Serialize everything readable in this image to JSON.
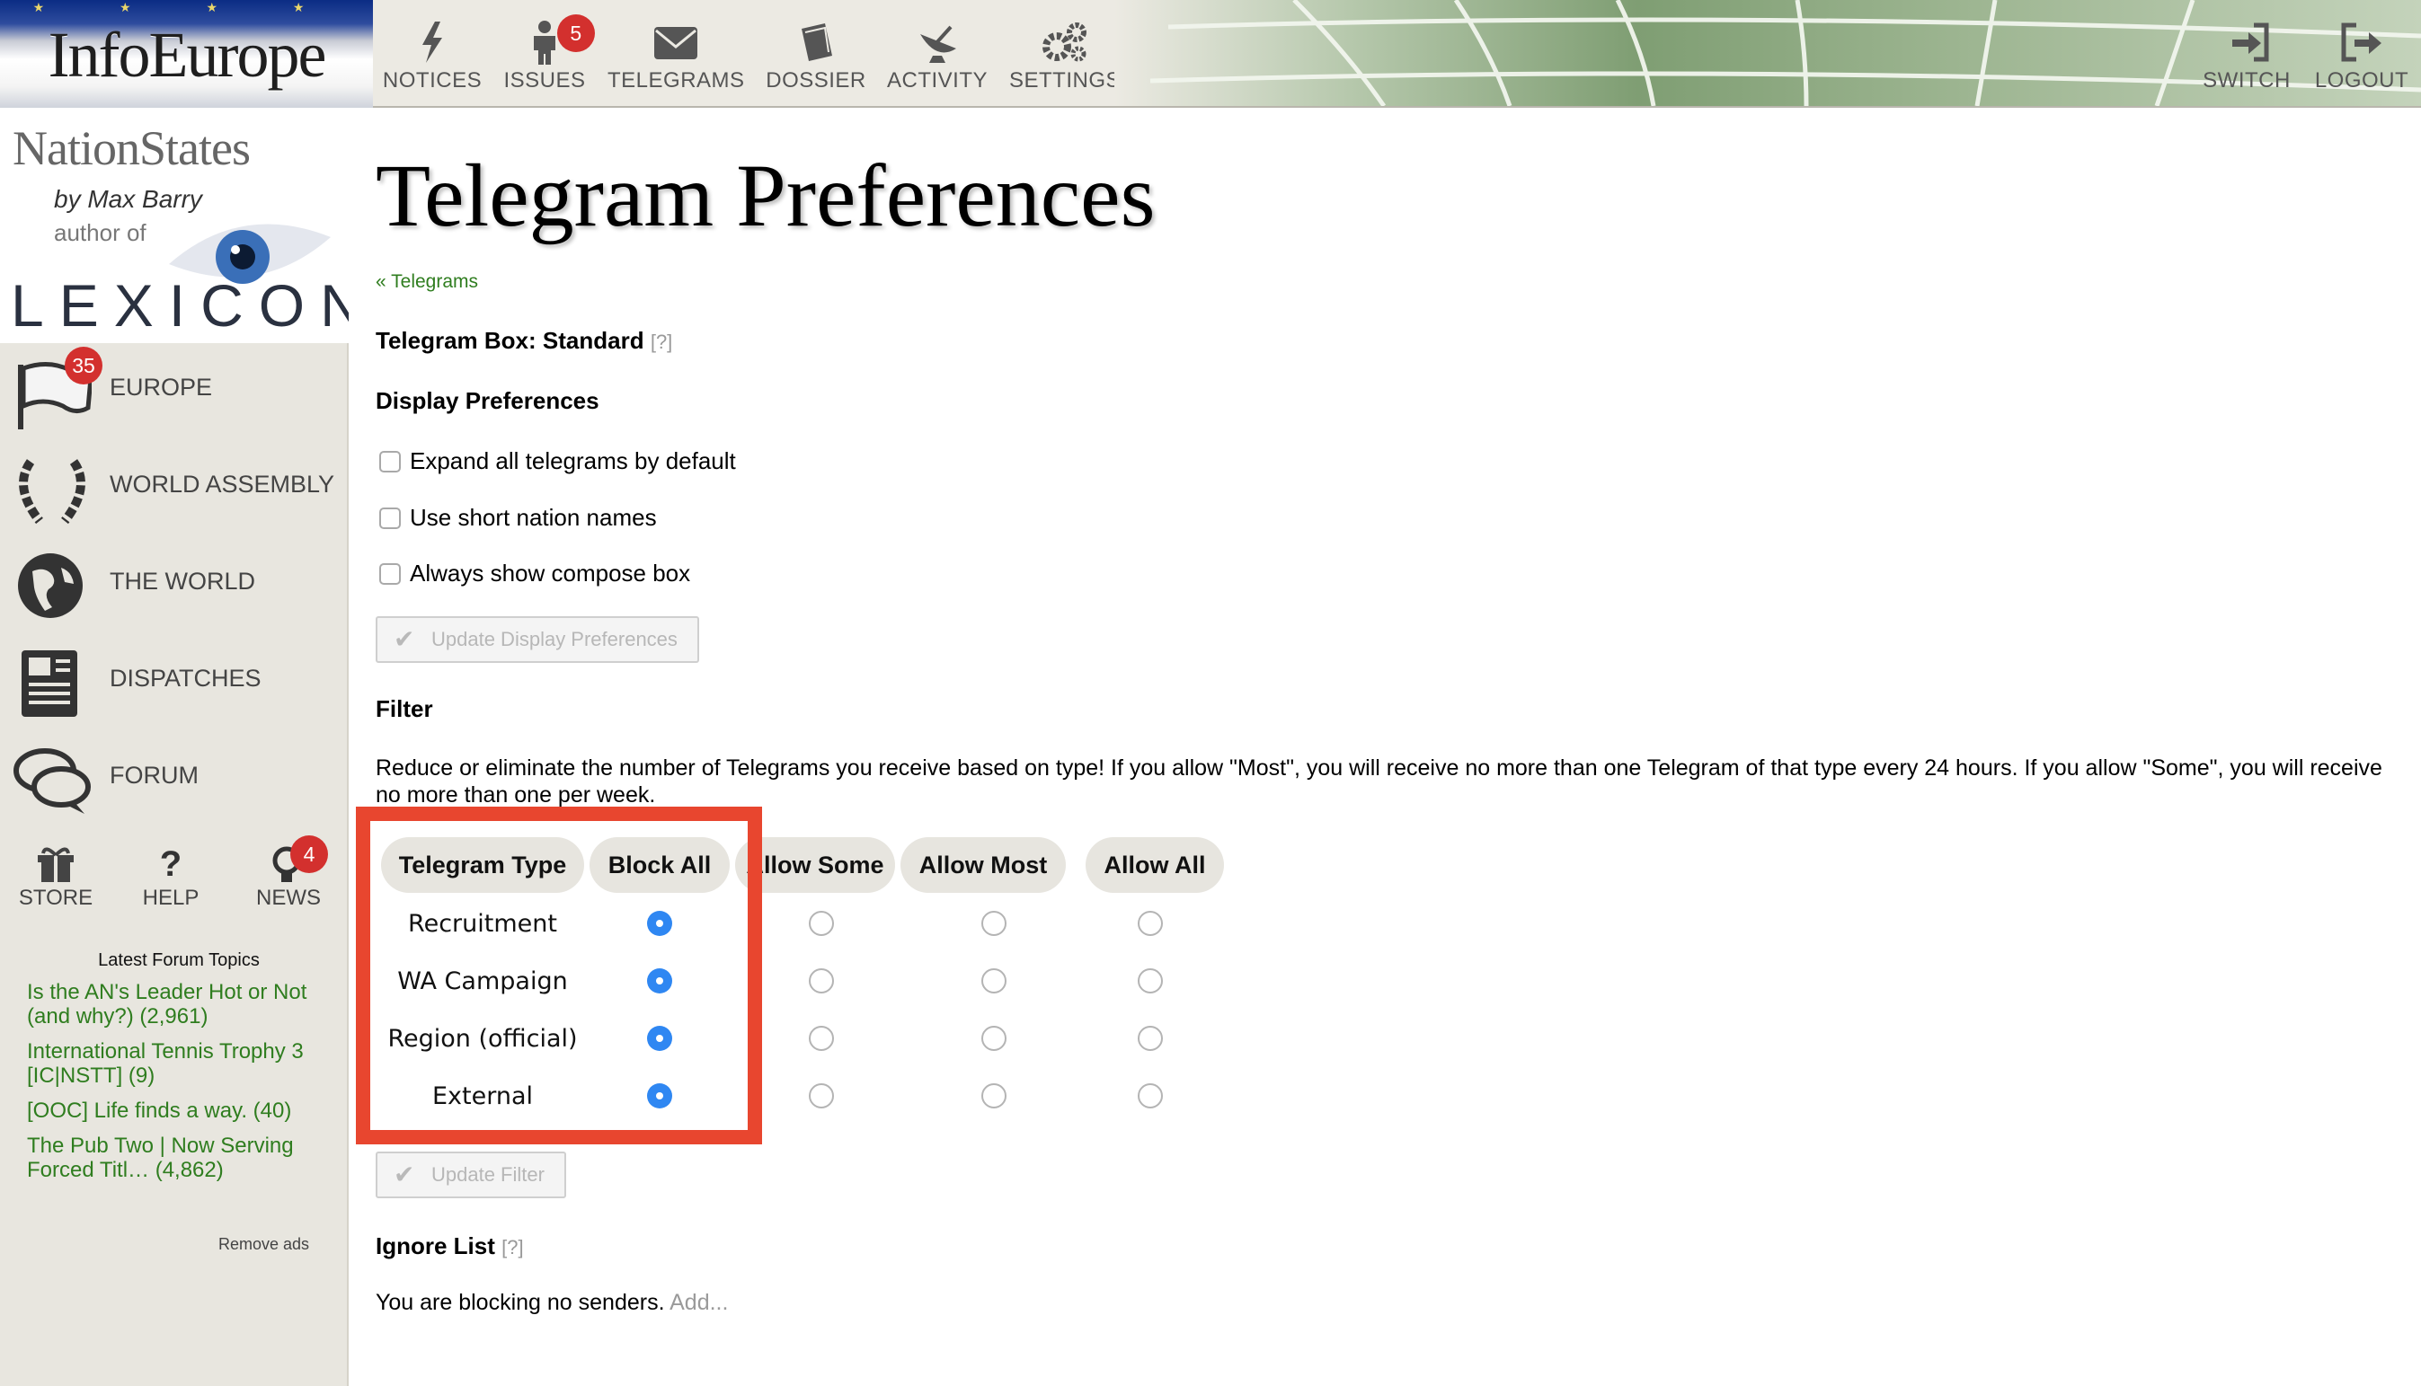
{
  "banner": {
    "title": "InfoEurope",
    "stars": "★ ★ ★ ★"
  },
  "nav": [
    {
      "key": "notices",
      "label": "NOTICES",
      "icon": "lightning-icon"
    },
    {
      "key": "issues",
      "label": "ISSUES",
      "icon": "person-icon",
      "badge": "5"
    },
    {
      "key": "telegrams",
      "label": "TELEGRAMS",
      "icon": "envelope-icon"
    },
    {
      "key": "dossier",
      "label": "DOSSIER",
      "icon": "book-icon"
    },
    {
      "key": "activity",
      "label": "ACTIVITY",
      "icon": "satellite-dish-icon"
    },
    {
      "key": "settings",
      "label": "SETTINGS",
      "icon": "gears-icon"
    }
  ],
  "nav_right": [
    {
      "key": "switch",
      "label": "SWITCH",
      "icon": "sign-in-icon"
    },
    {
      "key": "logout",
      "label": "LOGOUT",
      "icon": "sign-out-icon"
    }
  ],
  "sidebar": {
    "logo": {
      "nationstates": "NationStates",
      "byline": "by Max Barry",
      "author": "author of",
      "book": "LEXICON"
    },
    "items": [
      {
        "label": "EUROPE",
        "icon": "region-flag-icon",
        "badge": "35"
      },
      {
        "label": "WORLD ASSEMBLY",
        "icon": "laurel-wreath-icon"
      },
      {
        "label": "THE WORLD",
        "icon": "globe-icon"
      },
      {
        "label": "DISPATCHES",
        "icon": "newspaper-icon"
      },
      {
        "label": "FORUM",
        "icon": "speech-bubbles-icon"
      }
    ],
    "tools": [
      {
        "label": "STORE",
        "icon": "gift-icon"
      },
      {
        "label": "HELP",
        "icon": "question-icon"
      },
      {
        "label": "NEWS",
        "icon": "lightbulb-icon",
        "badge": "4"
      }
    ],
    "forum": {
      "heading": "Latest Forum Topics",
      "topics": [
        "Is the AN's Leader Hot or Not (and why?) (2,961)",
        "International Tennis Trophy 3 [IC|NSTT] (9)",
        "[OOC] Life finds a way. (40)",
        "The Pub Two | Now Serving Forced Titl… (4,862)"
      ]
    },
    "remove_ads": "Remove ads"
  },
  "main": {
    "title": "Telegram Preferences",
    "back_link": "« Telegrams",
    "box_label": "Telegram Box: Standard",
    "help_mark": "[?]",
    "display_heading": "Display Preferences",
    "checkboxes": [
      {
        "label": "Expand all telegrams by default",
        "checked": false
      },
      {
        "label": "Use short nation names",
        "checked": false
      },
      {
        "label": "Always show compose box",
        "checked": false
      }
    ],
    "update_display_btn": "Update Display Preferences",
    "filter_heading": "Filter",
    "filter_text": "Reduce or eliminate the number of Telegrams you receive based on type! If you allow \"Most\", you will receive no more than one Telegram of that type every 24 hours. If you allow \"Some\", you will receive no more than one per week.",
    "table": {
      "headers": [
        "Telegram Type",
        "Block All",
        "Allow Some",
        "Allow Most",
        "Allow All"
      ],
      "rows": [
        {
          "type": "Recruitment",
          "selected": "Block All"
        },
        {
          "type": "WA Campaign",
          "selected": "Block All"
        },
        {
          "type": "Region (official)",
          "selected": "Block All"
        },
        {
          "type": "External",
          "selected": "Block All"
        }
      ]
    },
    "update_filter_btn": "Update Filter",
    "ignore_heading": "Ignore List",
    "ignore_text": "You are blocking no senders.",
    "ignore_add": "Add..."
  },
  "colors": {
    "highlight": "#e8462f",
    "link": "#2f7d1f",
    "radio_selected": "#2f87f2",
    "badge": "#d3302e"
  }
}
